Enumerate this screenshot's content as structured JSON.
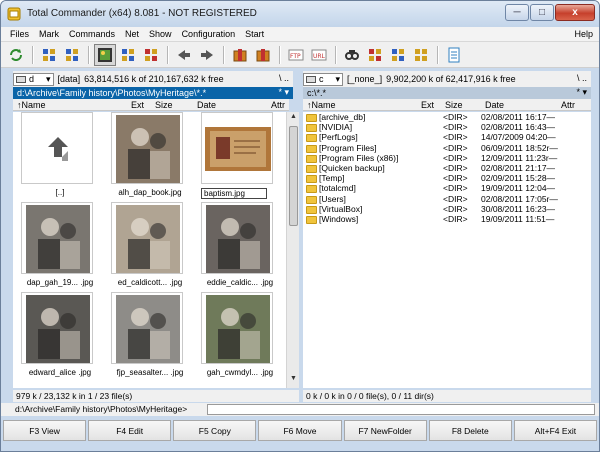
{
  "window": {
    "title": "Total Commander (x64) 8.081 - NOT REGISTERED",
    "minimize": "─",
    "maximize": "□",
    "close": "x"
  },
  "menu": [
    "Files",
    "Mark",
    "Commands",
    "Net",
    "Show",
    "Configuration",
    "Start"
  ],
  "menu_help": "Help",
  "toolbar": [
    {
      "icon": "refresh-icon",
      "color": "#2e8b2e"
    },
    {
      "icon": "icon-view-icon",
      "color": "#3060c0"
    },
    {
      "icon": "details-view-icon",
      "color": "#3060c0"
    },
    {
      "icon": "thumbnail-view-icon",
      "color": "#2e8b2e",
      "active": true
    },
    {
      "icon": "tree-view-icon",
      "color": "#3060c0"
    },
    {
      "icon": "invert-selection-icon",
      "color": "#c03030"
    },
    {
      "icon": "back-icon",
      "color": "#555555"
    },
    {
      "icon": "forward-icon",
      "color": "#555555"
    },
    {
      "icon": "pack-icon",
      "color": "#d08020"
    },
    {
      "icon": "unpack-icon",
      "color": "#d08020"
    },
    {
      "icon": "ftp-connect-icon",
      "color": "#c03030"
    },
    {
      "icon": "url-connect-icon",
      "color": "#c03030"
    },
    {
      "icon": "search-icon",
      "color": "#333333"
    },
    {
      "icon": "multi-rename-icon",
      "color": "#c03030"
    },
    {
      "icon": "sync-dirs-icon",
      "color": "#3060c0"
    },
    {
      "icon": "compare-icon",
      "color": "#d0a020"
    },
    {
      "icon": "notepad-icon",
      "color": "#3080c0"
    }
  ],
  "left_panel": {
    "drive": "d",
    "volume": "[data]",
    "free": "63,814,516 k of 210,167,632 k free",
    "nav": "\\   ..",
    "path": "d:\\Archive\\Family history\\Photos\\MyHeritage\\*.*",
    "path_right": "* ▾",
    "columns": {
      "name": "Name",
      "ext": "Ext",
      "size": "Size",
      "date": "Date",
      "attr": "Attr"
    },
    "thumbnails": [
      {
        "label": "[..]",
        "kind": "up"
      },
      {
        "label": "alh_dap_book.jpg",
        "kind": "photo",
        "tone": "#8a7a68"
      },
      {
        "label": "baptism.jpg",
        "kind": "doc",
        "tone": "#b0763a",
        "editing": true
      },
      {
        "label": "dap_gah_19... .jpg",
        "kind": "photo",
        "tone": "#7a7670"
      },
      {
        "label": "ed_caldicott... .jpg",
        "kind": "photo",
        "tone": "#b0a493"
      },
      {
        "label": "eddie_caldic... .jpg",
        "kind": "photo",
        "tone": "#6a6460"
      },
      {
        "label": "edward_alice .jpg",
        "kind": "photo",
        "tone": "#5a5854"
      },
      {
        "label": "fjp_seasalter... .jpg",
        "kind": "photo",
        "tone": "#8e8c88"
      },
      {
        "label": "gah_cwmdyl... .jpg",
        "kind": "photo",
        "tone": "#6f7a5a"
      }
    ],
    "status": "979 k / 23,132 k in 1 / 23 file(s)"
  },
  "right_panel": {
    "drive": "c",
    "volume": "[_none_]",
    "free": "9,902,200 k of 62,417,916 k free",
    "nav": "\\   ..",
    "path": "c:\\*.*",
    "path_right": "* ▾",
    "columns": {
      "name": "Name",
      "ext": "Ext",
      "size": "Size",
      "date": "Date",
      "attr": "Attr"
    },
    "files": [
      {
        "name": "[archive_db]",
        "size": "<DIR>",
        "date": "02/08/2011 16:17—"
      },
      {
        "name": "[NVIDIA]",
        "size": "<DIR>",
        "date": "02/08/2011 16:43—"
      },
      {
        "name": "[PerfLogs]",
        "size": "<DIR>",
        "date": "14/07/2009 04:20—"
      },
      {
        "name": "[Program Files]",
        "size": "<DIR>",
        "date": "06/09/2011 18:52r—"
      },
      {
        "name": "[Program Files (x86)]",
        "size": "<DIR>",
        "date": "12/09/2011 11:23r—"
      },
      {
        "name": "[Quicken backup]",
        "size": "<DIR>",
        "date": "02/08/2011 21:17—"
      },
      {
        "name": "[Temp]",
        "size": "<DIR>",
        "date": "02/09/2011 15:28—"
      },
      {
        "name": "[totalcmd]",
        "size": "<DIR>",
        "date": "19/09/2011 12:04—"
      },
      {
        "name": "[Users]",
        "size": "<DIR>",
        "date": "02/08/2011 17:05r—"
      },
      {
        "name": "[VirtualBox]",
        "size": "<DIR>",
        "date": "30/08/2011 16:23—"
      },
      {
        "name": "[Windows]",
        "size": "<DIR>",
        "date": "19/09/2011 11:51—"
      }
    ],
    "status": "0 k / 0 k in 0 / 0 file(s), 0 / 11 dir(s)"
  },
  "command_line": {
    "prompt": "d:\\Archive\\Family history\\Photos\\MyHeritage>",
    "value": ""
  },
  "fkeys": [
    "F3 View",
    "F4 Edit",
    "F5 Copy",
    "F6 Move",
    "F7 NewFolder",
    "F8 Delete",
    "Alt+F4 Exit"
  ]
}
